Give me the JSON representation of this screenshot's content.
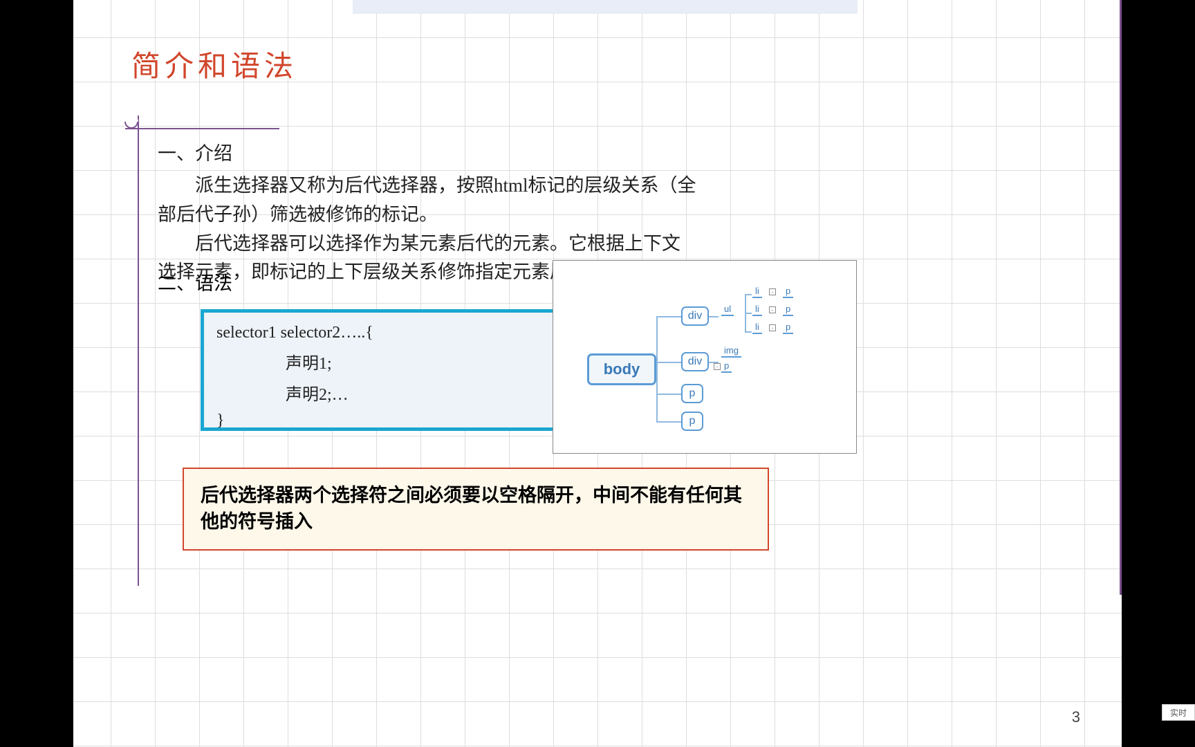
{
  "title": "简介和语法",
  "section1": {
    "heading": "一、介绍",
    "para1": "派生选择器又称为后代选择器，按照html标记的层级关系（全部后代子孙）筛选被修饰的标记。",
    "para2": "后代选择器可以选择作为某元素后代的元素。它根据上下文选择元素，即标记的上下层级关系修饰指定元素属性。"
  },
  "section2": {
    "heading": "二、语法"
  },
  "code": {
    "line1": "selector1 selector2…..{",
    "line2": "声明1;",
    "line3": "声明2;…",
    "line4": "}"
  },
  "diagram": {
    "root": "body",
    "children": [
      {
        "tag": "div",
        "children": [
          {
            "tag": "ul",
            "children": [
              "li",
              "li",
              "li"
            ],
            "grand": [
              "p",
              "p",
              "p"
            ]
          }
        ]
      },
      {
        "tag": "div",
        "children": [
          "img",
          "p"
        ]
      },
      {
        "tag": "p"
      },
      {
        "tag": "p"
      }
    ],
    "labels": {
      "div": "div",
      "ul": "ul",
      "li": "li",
      "p": "p",
      "img": "img"
    }
  },
  "note": "后代选择器两个选择符之间必须要以空格隔开，中间不能有任何其他的符号插入",
  "page_number": "3",
  "realtime_button": "实时"
}
